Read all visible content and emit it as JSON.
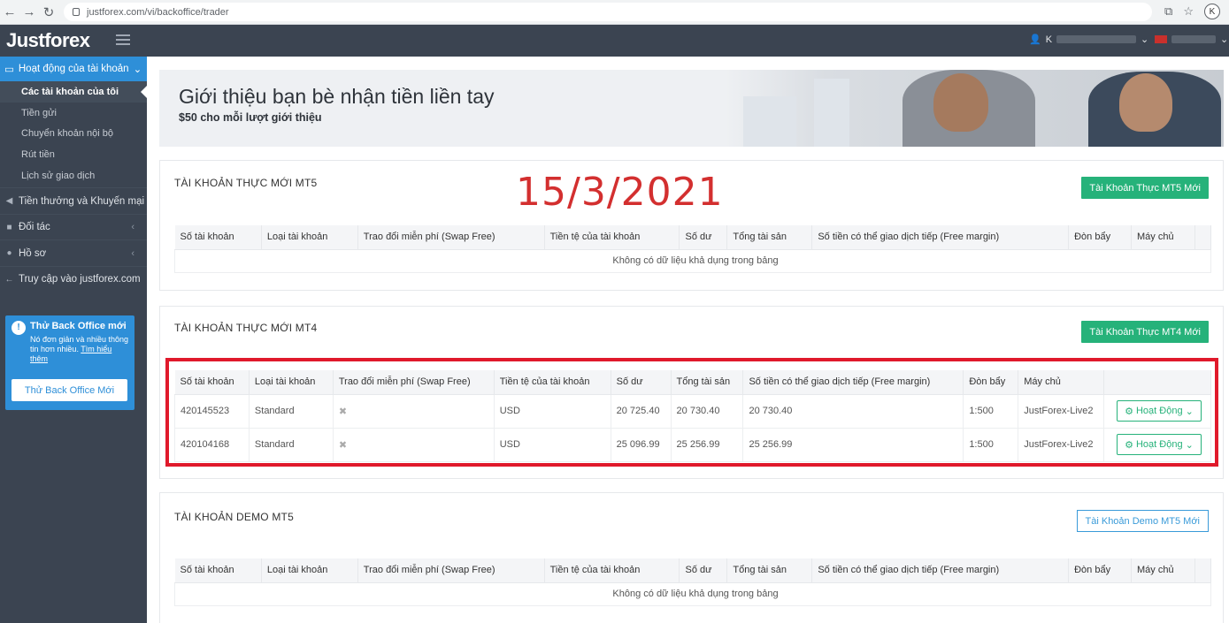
{
  "browser": {
    "url": "justforex.com/vi/backoffice/trader",
    "profile_initial": "K"
  },
  "topbar": {
    "logo": "Justforex",
    "user_initial": "K"
  },
  "sidebar": {
    "section_label": "Hoạt động của tài khoản",
    "sub_items": [
      {
        "label": "Các tài khoản của tôi"
      },
      {
        "label": "Tiền gửi"
      },
      {
        "label": "Chuyển khoản nội bộ"
      },
      {
        "label": "Rút tiền"
      },
      {
        "label": "Lịch sử giao dịch"
      }
    ],
    "items": [
      {
        "label": "Tiền thưởng và Khuyến mại"
      },
      {
        "label": "Đối tác"
      },
      {
        "label": "Hồ sơ"
      },
      {
        "label": "Truy cập vào justforex.com"
      }
    ],
    "promo": {
      "title": "Thử Back Office mới",
      "text": "Nó đơn giản và nhiều thông tin hơn nhiều.",
      "link": "Tìm hiểu thêm",
      "button": "Thử Back Office Mới"
    }
  },
  "banner": {
    "title": "Giới thiệu bạn bè nhận tiền liền tay",
    "subtitle": "$50 cho mỗi lượt giới thiệu"
  },
  "annotation": "15/3/2021",
  "headers": {
    "account_no": "Số tài khoản",
    "account_type": "Loại tài khoản",
    "swap_free": "Trao đổi miễn phí (Swap Free)",
    "currency": "Tiền tệ của tài khoản",
    "balance": "Số dư",
    "equity": "Tổng tài sản",
    "free_margin": "Số tiền có thể giao dịch tiếp (Free margin)",
    "leverage": "Đòn bẩy",
    "server": "Máy chủ"
  },
  "empty_text": "Không có dữ liệu khả dụng trong bảng",
  "mt5_real": {
    "title": "TÀI KHOẢN THỰC MỚI MT5",
    "button": "Tài Khoản Thực MT5 Mới"
  },
  "mt4_real": {
    "title": "TÀI KHOẢN THỰC MỚI MT4",
    "button": "Tài Khoản Thực MT4 Mới",
    "action_label": "Hoạt Động",
    "rows": [
      {
        "account_no": "420145523",
        "type": "Standard",
        "swap": "✖",
        "currency": "USD",
        "balance": "20 725.40",
        "equity": "20 730.40",
        "free_margin": "20 730.40",
        "leverage": "1:500",
        "server": "JustForex-Live2"
      },
      {
        "account_no": "420104168",
        "type": "Standard",
        "swap": "✖",
        "currency": "USD",
        "balance": "25 096.99",
        "equity": "25 256.99",
        "free_margin": "25 256.99",
        "leverage": "1:500",
        "server": "JustForex-Live2"
      }
    ]
  },
  "mt5_demo": {
    "title": "TÀI KHOẢN DEMO MT5",
    "button": "Tài Khoản Demo MT5 Mới"
  },
  "colors": {
    "sidebar": "#3b4451",
    "accent_blue": "#2e8fd8",
    "green": "#26b27a",
    "annotation_red": "#e0192b"
  }
}
